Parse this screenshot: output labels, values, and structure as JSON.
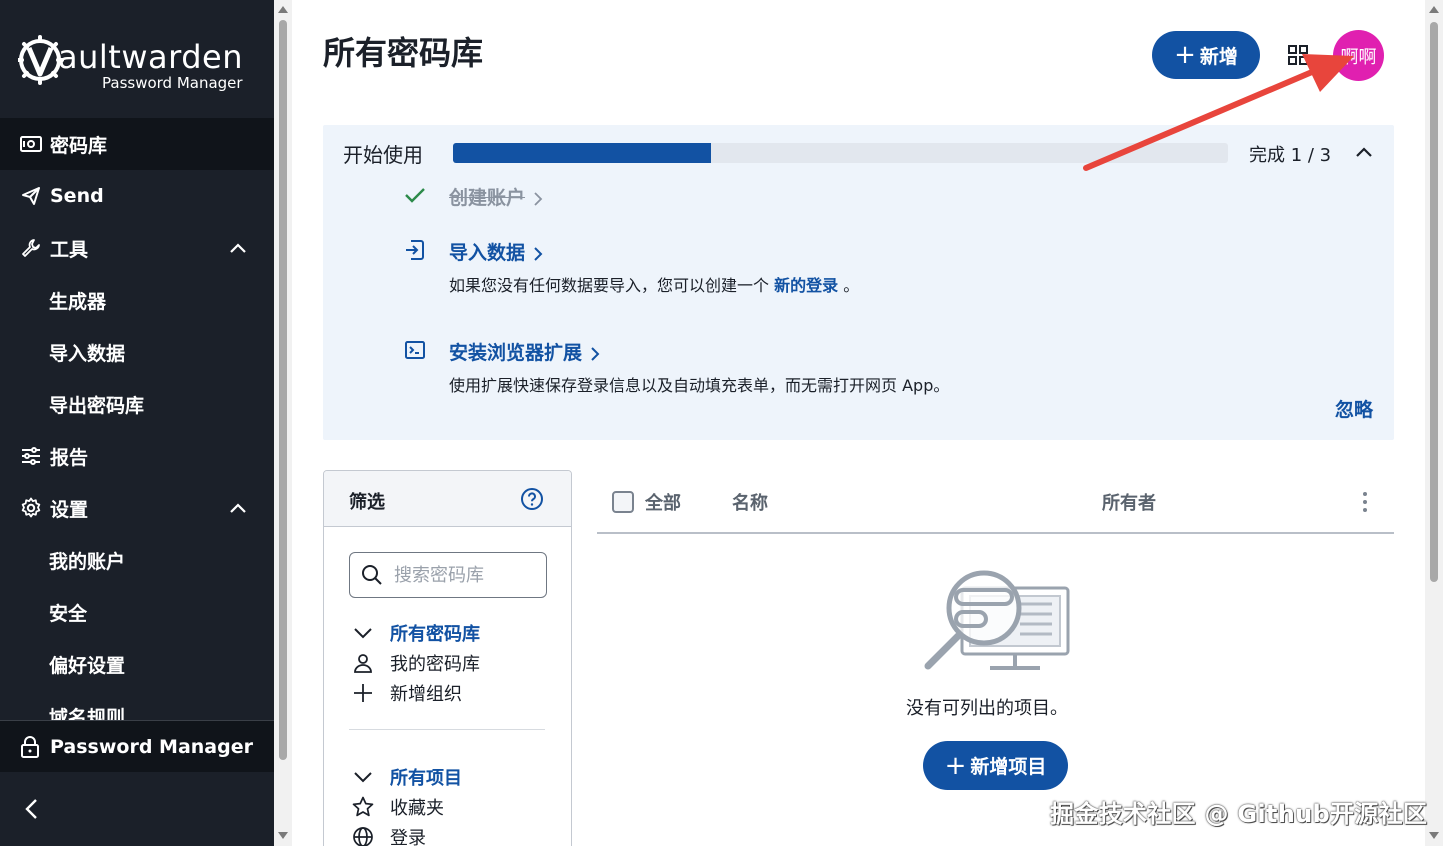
{
  "app": {
    "logo_word": "aultwarden",
    "logo_sub": "Password Manager"
  },
  "sidebar": {
    "items": [
      {
        "label": "密码库",
        "icon": "vault-icon",
        "active": true
      },
      {
        "label": "Send",
        "icon": "send-icon"
      },
      {
        "label": "工具",
        "icon": "wrench-icon",
        "expanded": true
      },
      {
        "label": "生成器",
        "sub": true
      },
      {
        "label": "导入数据",
        "sub": true
      },
      {
        "label": "导出密码库",
        "sub": true
      },
      {
        "label": "报告",
        "icon": "sliders-icon"
      },
      {
        "label": "设置",
        "icon": "gear-icon",
        "expanded": true
      },
      {
        "label": "我的账户",
        "sub": true
      },
      {
        "label": "安全",
        "sub": true
      },
      {
        "label": "偏好设置",
        "sub": true
      },
      {
        "label": "域名规则",
        "sub": true
      }
    ],
    "product_switcher": "Password Manager"
  },
  "header": {
    "title": "所有密码库",
    "new_button": "新增",
    "avatar_text": "啊啊"
  },
  "getting_started": {
    "title": "开始使用",
    "progress": 0.333,
    "count_text": "完成 1 / 3",
    "steps": [
      {
        "title": "创建账户",
        "done": true
      },
      {
        "title": "导入数据",
        "desc_before": "如果您没有任何数据要导入，您可以创建一个 ",
        "desc_link": "新的登录",
        "desc_after": " 。"
      },
      {
        "title": "安装浏览器扩展",
        "desc": "使用扩展快速保存登录信息以及自动填充表单，而无需打开网页 App。"
      }
    ],
    "dismiss": "忽略"
  },
  "filter": {
    "title": "筛选",
    "search_placeholder": "搜索密码库",
    "vaults": [
      {
        "label": "所有密码库",
        "head": true
      },
      {
        "label": "我的密码库"
      },
      {
        "label": "新增组织"
      }
    ],
    "types": [
      {
        "label": "所有项目",
        "head": true
      },
      {
        "label": "收藏夹"
      },
      {
        "label": "登录"
      }
    ]
  },
  "table": {
    "col_all": "全部",
    "col_name": "名称",
    "col_owner": "所有者",
    "empty_text": "没有可列出的项目。",
    "add_item": "新增项目"
  },
  "watermark": "掘金技术社区 @ Github开源社区",
  "colors": {
    "sidebar_bg": "#1b2029",
    "primary": "#1252a3",
    "avatar": "#e020b0",
    "card_bg": "#eef4fb",
    "annotation_arrow": "#e8453c"
  }
}
